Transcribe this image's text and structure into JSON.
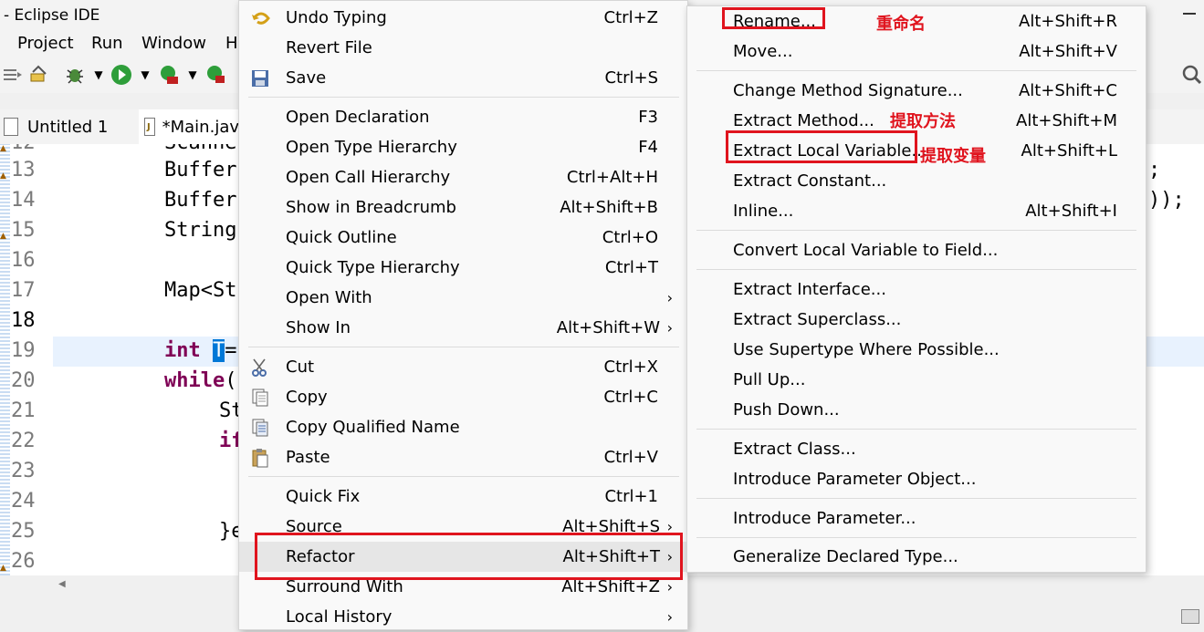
{
  "window": {
    "title": "- Eclipse IDE"
  },
  "menubar": {
    "items": [
      {
        "label": "Project"
      },
      {
        "label": "Run"
      },
      {
        "label": "Window"
      },
      {
        "label": "H"
      }
    ]
  },
  "tabs": [
    {
      "label": "Untitled 1"
    },
    {
      "label": "*Main.jav"
    }
  ],
  "editor": {
    "line_numbers": [
      "12",
      "13",
      "14",
      "15",
      "16",
      "17",
      "18",
      "19",
      "20",
      "21",
      "22",
      "23",
      "24",
      "25",
      "26"
    ],
    "current_line": "18",
    "code": {
      "l12": "Scanne",
      "l13": "Buffer",
      "l14": "Buffer",
      "l15": "String",
      "l17": "Map<St",
      "l19_kw": "int",
      "l19_sel": "T",
      "l19_rest": "=",
      "l20_kw": "while",
      "l20_rest": "(",
      "l21": "St",
      "l22_kw": "if",
      "l25": "}e",
      "r13": ";",
      "r14": "));"
    }
  },
  "context_menu": {
    "items": [
      {
        "label": "Undo Typing",
        "accel": "Ctrl+Z",
        "icon": "undo-icon"
      },
      {
        "label": "Revert File",
        "accel": ""
      },
      {
        "label": "Save",
        "accel": "Ctrl+S",
        "icon": "save-icon"
      },
      {
        "label": "Open Declaration",
        "accel": "F3"
      },
      {
        "label": "Open Type Hierarchy",
        "accel": "F4"
      },
      {
        "label": "Open Call Hierarchy",
        "accel": "Ctrl+Alt+H"
      },
      {
        "label": "Show in Breadcrumb",
        "accel": "Alt+Shift+B"
      },
      {
        "label": "Quick Outline",
        "accel": "Ctrl+O"
      },
      {
        "label": "Quick Type Hierarchy",
        "accel": "Ctrl+T"
      },
      {
        "label": "Open With",
        "accel": "",
        "submenu": true
      },
      {
        "label": "Show In",
        "accel": "Alt+Shift+W",
        "submenu": true
      },
      {
        "label": "Cut",
        "accel": "Ctrl+X",
        "icon": "cut-icon"
      },
      {
        "label": "Copy",
        "accel": "Ctrl+C",
        "icon": "copy-icon"
      },
      {
        "label": "Copy Qualified Name",
        "accel": "",
        "icon": "copy-qualified-icon"
      },
      {
        "label": "Paste",
        "accel": "Ctrl+V",
        "icon": "paste-icon"
      },
      {
        "label": "Quick Fix",
        "accel": "Ctrl+1"
      },
      {
        "label": "Source",
        "accel": "Alt+Shift+S",
        "submenu": true
      },
      {
        "label": "Refactor",
        "accel": "Alt+Shift+T",
        "submenu": true
      },
      {
        "label": "Surround With",
        "accel": "Alt+Shift+Z",
        "submenu": true
      },
      {
        "label": "Local History",
        "accel": "",
        "submenu": true
      }
    ],
    "submenu_arrow": "›"
  },
  "refactor_menu": {
    "items": [
      {
        "label": "Rename...",
        "accel": "Alt+Shift+R"
      },
      {
        "label": "Move...",
        "accel": "Alt+Shift+V"
      },
      {
        "label": "Change Method Signature...",
        "accel": "Alt+Shift+C"
      },
      {
        "label": "Extract Method...",
        "accel": "Alt+Shift+M"
      },
      {
        "label": "Extract Local Variable...",
        "accel": "Alt+Shift+L"
      },
      {
        "label": "Extract Constant...",
        "accel": ""
      },
      {
        "label": "Inline...",
        "accel": "Alt+Shift+I"
      },
      {
        "label": "Convert Local Variable to Field...",
        "accel": ""
      },
      {
        "label": "Extract Interface...",
        "accel": ""
      },
      {
        "label": "Extract Superclass...",
        "accel": ""
      },
      {
        "label": "Use Supertype Where Possible...",
        "accel": ""
      },
      {
        "label": "Pull Up...",
        "accel": ""
      },
      {
        "label": "Push Down...",
        "accel": ""
      },
      {
        "label": "Extract Class...",
        "accel": ""
      },
      {
        "label": "Introduce Parameter Object...",
        "accel": ""
      },
      {
        "label": "Introduce Parameter...",
        "accel": ""
      },
      {
        "label": "Generalize Declared Type...",
        "accel": ""
      }
    ]
  },
  "annotations": {
    "rename": "重命名",
    "extract_method": "提取方法",
    "extract_variable": "提取变量",
    "color": "#e0141e"
  }
}
